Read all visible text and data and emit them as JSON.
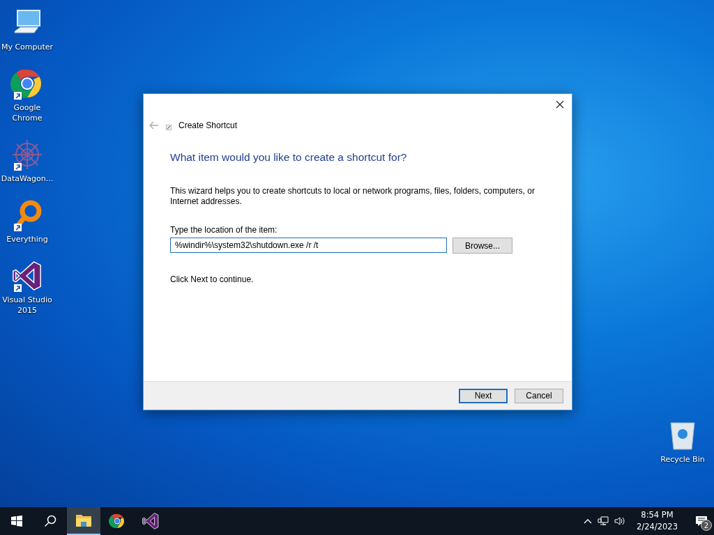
{
  "desktop_icons": [
    {
      "label": "My Computer",
      "kind": "computer",
      "shortcut": false
    },
    {
      "label": "Google Chrome",
      "kind": "chrome",
      "shortcut": true
    },
    {
      "label": "DataWagon...",
      "kind": "datawagon",
      "shortcut": true
    },
    {
      "label": "Everything",
      "kind": "everything",
      "shortcut": true
    },
    {
      "label": "Visual Studio 2015",
      "kind": "visualstudio",
      "shortcut": true
    }
  ],
  "recycle_bin": {
    "label": "Recycle Bin"
  },
  "dialog": {
    "title": "Create Shortcut",
    "heading": "What item would you like to create a shortcut for?",
    "description": "This wizard helps you to create shortcuts to local or network programs, files, folders, computers, or Internet addresses.",
    "field_label": "Type the location of the item:",
    "location": "%windir%\\system32\\shutdown.exe /r /t",
    "browse_button": "Browse...",
    "instruction": "Click Next to continue.",
    "buttons": [
      {
        "label": "Next",
        "default": true
      },
      {
        "label": "Cancel",
        "default": false
      }
    ]
  },
  "taskbar": {
    "items": [
      {
        "kind": "start",
        "active": false
      },
      {
        "kind": "search",
        "active": false
      },
      {
        "kind": "explorer",
        "active": true
      },
      {
        "kind": "chrome",
        "active": false
      },
      {
        "kind": "visualstudio",
        "active": false
      }
    ],
    "time": "8:54 PM",
    "date": "2/24/2023",
    "notification_count": "2"
  }
}
